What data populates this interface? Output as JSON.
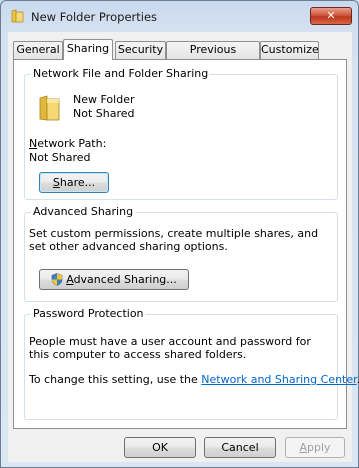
{
  "window": {
    "title": "New Folder Properties",
    "close_glyph": "✕"
  },
  "tabs": [
    {
      "label": "General",
      "active": false
    },
    {
      "label": "Sharing",
      "active": true
    },
    {
      "label": "Security",
      "active": false
    },
    {
      "label": "Previous Versions",
      "active": false
    },
    {
      "label": "Customize",
      "active": false
    }
  ],
  "network_sharing": {
    "title": "Network File and Folder Sharing",
    "folder_name": "New Folder",
    "folder_status": "Not Shared",
    "network_path_label_prefix": "N",
    "network_path_label_rest": "etwork Path:",
    "network_path_value": "Not Shared",
    "share_button_prefix": "S",
    "share_button_rest": "hare..."
  },
  "advanced_sharing": {
    "title": "Advanced Sharing",
    "description": "Set custom permissions, create multiple shares, and set other advanced sharing options.",
    "button_prefix": "A",
    "button_rest": "dvanced Sharing..."
  },
  "password_protection": {
    "title": "Password Protection",
    "description": "People must have a user account and password for this computer to access shared folders.",
    "change_text": "To change this setting, use the ",
    "link_text": "Network and Sharing Center",
    "period": "."
  },
  "footer": {
    "ok": "OK",
    "cancel": "Cancel",
    "apply_prefix": "A",
    "apply_rest": "pply"
  },
  "icons": {
    "title": "folder-icon",
    "folder": "folder-icon",
    "uac": "shield-icon"
  }
}
